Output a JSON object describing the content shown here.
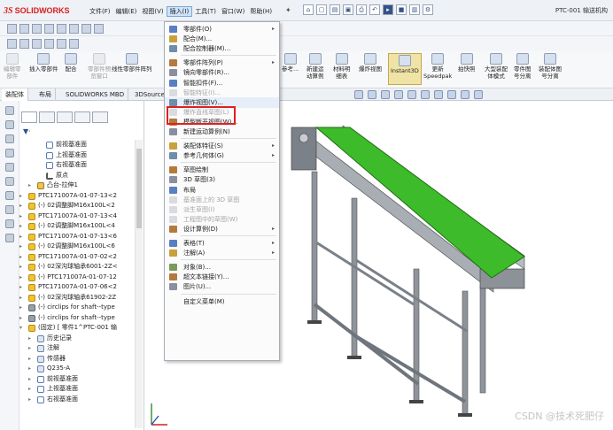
{
  "app": {
    "brand_ds": "3S",
    "brand_name": "SOLIDWORKS",
    "document_title": "PTC-001 输送机构"
  },
  "menu_bar": [
    {
      "label": "文件(F)"
    },
    {
      "label": "编辑(E)"
    },
    {
      "label": "视图(V)"
    },
    {
      "label": "插入(I)"
    },
    {
      "label": "工具(T)"
    },
    {
      "label": "窗口(W)"
    },
    {
      "label": "帮助(H)"
    }
  ],
  "command_manager": [
    {
      "label": "编辑零\n部件",
      "state": "disabled"
    },
    {
      "label": "插入零部件",
      "state": "normal"
    },
    {
      "label": "配合",
      "state": "normal"
    },
    {
      "label": "零部件预\n览窗口",
      "state": "disabled"
    },
    {
      "label": "线性零部件阵列",
      "state": "normal"
    },
    {
      "label": "参考...",
      "state": "normal"
    },
    {
      "label": "新建运\n动算例",
      "state": "normal"
    },
    {
      "label": "材料明\n细表",
      "state": "normal"
    },
    {
      "label": "爆炸视图",
      "state": "normal"
    },
    {
      "label": "Instant3D",
      "state": "selected"
    },
    {
      "label": "更新\nSpeedpak",
      "state": "normal"
    },
    {
      "label": "拍快照",
      "state": "normal"
    },
    {
      "label": "大型装配\n体模式",
      "state": "normal"
    },
    {
      "label": "零件图\n号分离",
      "state": "normal"
    },
    {
      "label": "装配体图\n号分离",
      "state": "normal"
    }
  ],
  "tabs": [
    {
      "label": "装配体"
    },
    {
      "label": "布局"
    },
    {
      "label": "SOLIDWORKS MBD"
    },
    {
      "label": "3DSource"
    }
  ],
  "feature_tree": [
    {
      "label": "前视基准面",
      "icon": "plane-icon",
      "depth": 2
    },
    {
      "label": "上视基准面",
      "icon": "plane-icon",
      "depth": 2
    },
    {
      "label": "右视基准面",
      "icon": "plane-icon",
      "depth": 2
    },
    {
      "label": "原点",
      "icon": "origin-icon",
      "depth": 2
    },
    {
      "label": "凸台-拉伸1",
      "icon": "feature-icon",
      "depth": 1
    },
    {
      "label": "PTC171007A-01-07-13<2",
      "icon": "part-icon",
      "depth": 0
    },
    {
      "label": "(-) 02调整脚M16x100L<2",
      "icon": "part-icon",
      "depth": 0
    },
    {
      "label": "PTC171007A-01-07-13<4",
      "icon": "part-icon",
      "depth": 0
    },
    {
      "label": "(-) 02调整脚M16x100L<4",
      "icon": "part-icon",
      "depth": 0
    },
    {
      "label": "PTC171007A-01-07-13<6",
      "icon": "part-icon",
      "depth": 0
    },
    {
      "label": "(-) 02调整脚M16x100L<6",
      "icon": "part-icon",
      "depth": 0
    },
    {
      "label": "PTC171007A-01-07-02<2",
      "icon": "part-icon",
      "depth": 0
    },
    {
      "label": "(-) 02深沟球轴承6001-2Z<",
      "icon": "part-icon",
      "depth": 0
    },
    {
      "label": "(-) PTC171007A-01-07-12",
      "icon": "part-icon",
      "depth": 0
    },
    {
      "label": "PTC171007A-01-07-06<2",
      "icon": "part-icon",
      "depth": 0
    },
    {
      "label": "(-) 02深沟球轴承61902-2Z",
      "icon": "part-icon",
      "depth": 0
    },
    {
      "label": "(-) circlips for shaft--type",
      "icon": "clip-icon",
      "depth": 0
    },
    {
      "label": "(-) circlips for shaft--type",
      "icon": "clip-icon",
      "depth": 0
    },
    {
      "label": "(固定) [ 零件1^PTC-001 输",
      "icon": "part-icon",
      "depth": 0
    },
    {
      "label": "历史记录",
      "icon": "doc-icon",
      "depth": 1
    },
    {
      "label": "注解",
      "icon": "doc-icon",
      "depth": 1
    },
    {
      "label": "传感器",
      "icon": "doc-icon",
      "depth": 1
    },
    {
      "label": "Q235-A",
      "icon": "doc-icon",
      "depth": 1
    },
    {
      "label": "前视基准面",
      "icon": "plane-icon",
      "depth": 1
    },
    {
      "label": "上视基准面",
      "icon": "plane-icon",
      "depth": 1
    },
    {
      "label": "右视基准面",
      "icon": "plane-icon",
      "depth": 1
    }
  ],
  "insert_menu": [
    {
      "label": "零部件(O)",
      "has_sub": true,
      "state": "normal",
      "icon": "component-icon"
    },
    {
      "label": "配合(M)...",
      "has_sub": false,
      "state": "normal",
      "icon": "mate-icon"
    },
    {
      "label": "配合控制器(M)...",
      "has_sub": false,
      "state": "normal",
      "icon": "mate-controller-icon"
    },
    {
      "sep": true
    },
    {
      "label": "零部件阵列(P)",
      "has_sub": true,
      "state": "normal",
      "icon": "pattern-icon"
    },
    {
      "label": "镜向零部件(R)...",
      "has_sub": false,
      "state": "normal",
      "icon": "mirror-icon"
    },
    {
      "label": "智能扣件(F)...",
      "has_sub": false,
      "state": "normal",
      "icon": "fastener-icon"
    },
    {
      "label": "智能特征(I)...",
      "has_sub": false,
      "state": "disabled",
      "icon": "smart-feature-icon"
    },
    {
      "label": "爆炸视图(V)...",
      "has_sub": false,
      "state": "highlight",
      "icon": "explode-icon"
    },
    {
      "label": "爆炸直线草图(L)",
      "has_sub": false,
      "state": "disabled",
      "icon": "explode-line-icon"
    },
    {
      "label": "模型断开视图(W)...",
      "has_sub": false,
      "state": "normal",
      "icon": "break-view-icon"
    },
    {
      "label": "新建运动算例(N)",
      "has_sub": false,
      "state": "normal",
      "icon": "motion-study-icon"
    },
    {
      "sep": true
    },
    {
      "label": "装配体特征(S)",
      "has_sub": true,
      "state": "normal",
      "icon": "assembly-feature-icon"
    },
    {
      "label": "参考几何体(G)",
      "has_sub": true,
      "state": "normal",
      "icon": "reference-geometry-icon"
    },
    {
      "sep": true
    },
    {
      "label": "草图绘制",
      "has_sub": false,
      "state": "normal",
      "icon": "sketch-icon"
    },
    {
      "label": "3D 草图(3)",
      "has_sub": false,
      "state": "normal",
      "icon": "sketch3d-icon"
    },
    {
      "label": "布局",
      "has_sub": false,
      "state": "normal",
      "icon": "layout-icon"
    },
    {
      "label": "基准面上的 3D 草图",
      "has_sub": false,
      "state": "disabled",
      "icon": "plane-sketch-icon"
    },
    {
      "label": "派生草图(I)",
      "has_sub": false,
      "state": "disabled",
      "icon": "derived-sketch-icon"
    },
    {
      "label": "工程图中的草图(W)",
      "has_sub": false,
      "state": "disabled",
      "icon": "drawing-sketch-icon"
    },
    {
      "label": "设计算例(D)",
      "has_sub": true,
      "state": "normal",
      "icon": "design-study-icon"
    },
    {
      "sep": true
    },
    {
      "label": "表格(T)",
      "has_sub": true,
      "state": "normal",
      "icon": "table-icon"
    },
    {
      "label": "注解(A)",
      "has_sub": true,
      "state": "normal",
      "icon": "annotation-icon"
    },
    {
      "sep": true
    },
    {
      "label": "对象(B)...",
      "has_sub": false,
      "state": "normal",
      "icon": "object-icon"
    },
    {
      "label": "超文本链接(Y)...",
      "has_sub": false,
      "state": "normal",
      "icon": "hyperlink-icon"
    },
    {
      "label": "图片(U)...",
      "has_sub": false,
      "state": "normal",
      "icon": "picture-icon"
    },
    {
      "sep": true
    },
    {
      "label": "自定义菜单(M)",
      "has_sub": false,
      "state": "normal",
      "icon": ""
    }
  ],
  "watermark": "CSDN @技术死肥仔",
  "colors": {
    "belt": "#3dbb2a",
    "frame": "#9ba0a6",
    "highlight_box": "#e02020",
    "brand": "#d6201e"
  }
}
